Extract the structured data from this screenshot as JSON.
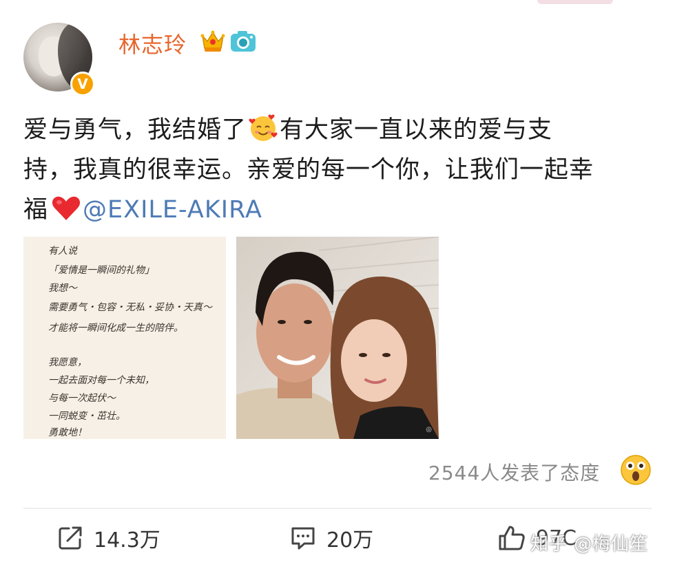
{
  "user": {
    "name": "林志玲",
    "verified_badge": "V"
  },
  "post": {
    "text_line_1a": "爱与勇气，我结婚了",
    "text_line_1b": "有大家一直以来的爱与支",
    "text_line_2": "持，我真的很幸运。亲爱的每一个你，让我们一起幸",
    "text_line_3a": "福",
    "mention": "@EXILE-AKIRA"
  },
  "images": {
    "note_lines": [
      "有人说",
      "「爱情是一瞬间的礼物」",
      "我想～",
      "需要勇气・包容・无私・妥协・天真～",
      "才能将一瞬间化成一生的陪伴。",
      "我愿意，",
      "一起去面对每一个未知，",
      "与每一次起伏～",
      "一同蜕变・茁壮。",
      "勇敢地！"
    ]
  },
  "reactions": {
    "text": "2544人发表了态度"
  },
  "actions": {
    "share_count": "14.3万",
    "comment_count": "20万",
    "like_count": "97C"
  },
  "watermark": "知乎 @梅仙笙",
  "colors": {
    "username": "#e8652c",
    "mention": "#4e7bb5",
    "verified": "#f8a100"
  }
}
